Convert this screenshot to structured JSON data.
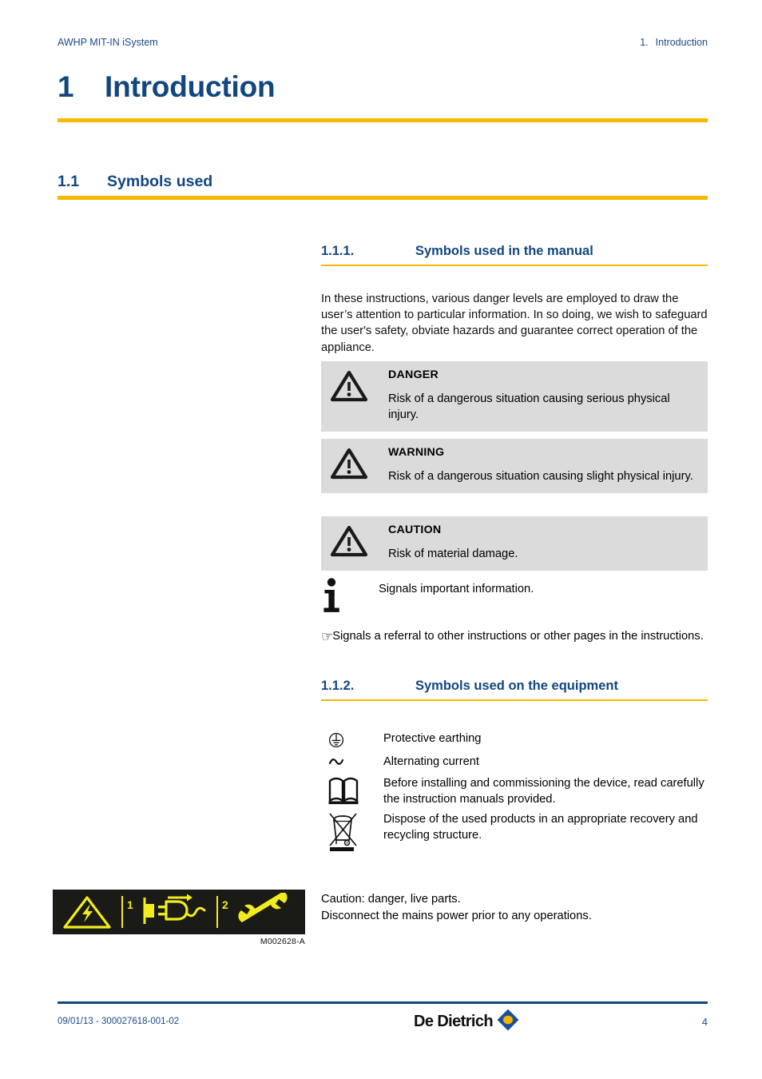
{
  "header": {
    "left": "AWHP MIT-IN iSystem",
    "right_num": "1.",
    "right_label": "Introduction"
  },
  "chapter": {
    "number": "1",
    "title": "Introduction"
  },
  "section": {
    "number": "1.1",
    "title": "Symbols used"
  },
  "subsections": [
    {
      "number": "1.1.1.",
      "title": "Symbols used in the manual"
    },
    {
      "number": "1.1.2.",
      "title": "Symbols used on the equipment"
    }
  ],
  "intro_paragraph": "In these instructions, various danger levels are employed to draw the user’s attention to particular information. In so doing, we wish to safeguard the user's safety, obviate hazards and guarantee correct operation of the appliance.",
  "warning_boxes": [
    {
      "icon": "warning-triangle-icon",
      "title": "DANGER",
      "body": "Risk of a dangerous situation causing serious physical injury."
    },
    {
      "icon": "warning-triangle-icon",
      "title": "WARNING",
      "body": "Risk of a dangerous situation causing slight physical injury."
    },
    {
      "icon": "warning-triangle-icon",
      "title": "CAUTION",
      "body": "Risk of material damage."
    }
  ],
  "info_note": {
    "icon": "information-i-icon",
    "text": "Signals important information."
  },
  "referral_note": {
    "icon": "pointing-hand-icon",
    "glyph": "☞",
    "text": "Signals a referral to other instructions or other pages in the instructions."
  },
  "equipment_symbols": [
    {
      "icon": "protective-earth-icon",
      "text": "Protective earthing"
    },
    {
      "icon": "alternating-current-icon",
      "glyph": "~",
      "text": "Alternating current"
    },
    {
      "icon": "open-book-icon",
      "text": "Before installing and commissioning the device, read carefully the instruction manuals provided."
    },
    {
      "icon": "crossed-out-wheelie-bin-icon",
      "text": "Dispose of the used products in an appropriate recovery and recycling structure."
    }
  ],
  "label_figure": {
    "caption": "M002628-A",
    "markers": [
      "1",
      "2"
    ],
    "icons": [
      "electrical-hazard-triangle-icon",
      "unplug-mains-icon",
      "wrench-icon"
    ],
    "background_color": "#1a1a17",
    "pictogram_color": "#f2ec1f"
  },
  "label_caution_text": "Caution: danger, live parts.\nDisconnect the mains power prior to any operations.",
  "footer": {
    "reference": "09/01/13 - 300027618-001-02",
    "brand": "De Dietrich",
    "page_number": "4"
  },
  "colors": {
    "heading_blue": "#12467f",
    "accent_yellow": "#F7B800",
    "warnbox_gray": "#dbdbdb",
    "logo_blue": "#1a4f9c",
    "logo_yellow": "#f5b500"
  }
}
